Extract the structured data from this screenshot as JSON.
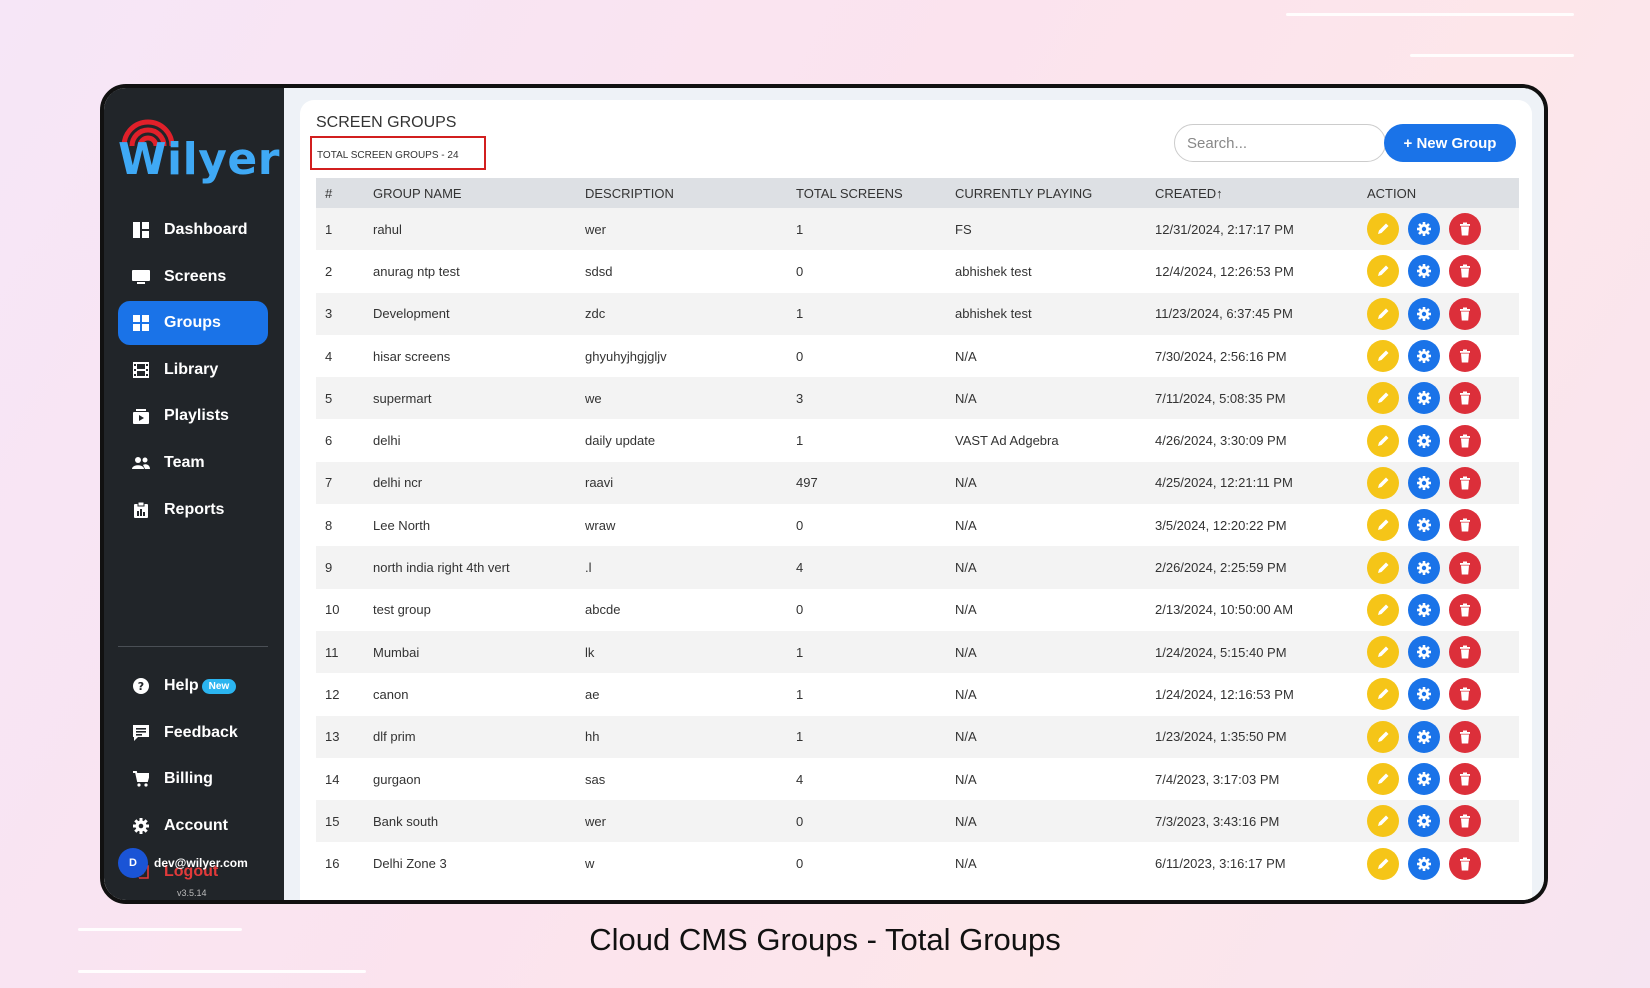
{
  "brand": {
    "name": "Wilyer"
  },
  "sidebar": {
    "items": [
      {
        "label": "Dashboard",
        "icon": "dashboard-icon",
        "active": false
      },
      {
        "label": "Screens",
        "icon": "monitor-icon",
        "active": false
      },
      {
        "label": "Groups",
        "icon": "grid-icon",
        "active": true
      },
      {
        "label": "Library",
        "icon": "film-icon",
        "active": false
      },
      {
        "label": "Playlists",
        "icon": "playlist-icon",
        "active": false
      },
      {
        "label": "Team",
        "icon": "team-icon",
        "active": false
      },
      {
        "label": "Reports",
        "icon": "clipboard-icon",
        "active": false
      }
    ],
    "secondary": [
      {
        "label": "Help",
        "icon": "question-icon",
        "badge": "New"
      },
      {
        "label": "Feedback",
        "icon": "feedback-icon"
      },
      {
        "label": "Billing",
        "icon": "cart-icon"
      },
      {
        "label": "Account",
        "icon": "gear-icon"
      },
      {
        "label": "Logout",
        "icon": "logout-icon"
      }
    ],
    "user": {
      "initial": "D",
      "email": "dev@wilyer.com",
      "version": "v3.5.14"
    }
  },
  "page": {
    "title": "SCREEN GROUPS",
    "total_label": "TOTAL SCREEN GROUPS - 24",
    "search_placeholder": "Search...",
    "new_group_label": "+ New Group"
  },
  "table": {
    "columns": [
      "#",
      "GROUP NAME",
      "DESCRIPTION",
      "TOTAL SCREENS",
      "CURRENTLY PLAYING",
      "CREATED↑",
      "ACTION"
    ],
    "rows": [
      [
        "1",
        "rahul",
        "wer",
        "1",
        "FS",
        "12/31/2024, 2:17:17 PM"
      ],
      [
        "2",
        "anurag ntp test",
        "sdsd",
        "0",
        "abhishek test",
        "12/4/2024, 12:26:53 PM"
      ],
      [
        "3",
        "Development",
        "zdc",
        "1",
        "abhishek test",
        "11/23/2024, 6:37:45 PM"
      ],
      [
        "4",
        "hisar screens",
        "ghyuhyjhgjgljv",
        "0",
        "N/A",
        "7/30/2024, 2:56:16 PM"
      ],
      [
        "5",
        "supermart",
        "we",
        "3",
        "N/A",
        "7/11/2024, 5:08:35 PM"
      ],
      [
        "6",
        "delhi",
        "daily update",
        "1",
        "VAST Ad Adgebra",
        "4/26/2024, 3:30:09 PM"
      ],
      [
        "7",
        "delhi ncr",
        "raavi",
        "497",
        "N/A",
        "4/25/2024, 12:21:11 PM"
      ],
      [
        "8",
        "Lee North",
        "wraw",
        "0",
        "N/A",
        "3/5/2024, 12:20:22 PM"
      ],
      [
        "9",
        "north india right 4th vert",
        ".l",
        "4",
        "N/A",
        "2/26/2024, 2:25:59 PM"
      ],
      [
        "10",
        "test group",
        "abcde",
        "0",
        "N/A",
        "2/13/2024, 10:50:00 AM"
      ],
      [
        "11",
        "Mumbai",
        "lk",
        "1",
        "N/A",
        "1/24/2024, 5:15:40 PM"
      ],
      [
        "12",
        "canon",
        "ae",
        "1",
        "N/A",
        "1/24/2024, 12:16:53 PM"
      ],
      [
        "13",
        "dlf prim",
        "hh",
        "1",
        "N/A",
        "1/23/2024, 1:35:50 PM"
      ],
      [
        "14",
        "gurgaon",
        "sas",
        "4",
        "N/A",
        "7/4/2023, 3:17:03 PM"
      ],
      [
        "15",
        "Bank south",
        "wer",
        "0",
        "N/A",
        "7/3/2023, 3:43:16 PM"
      ],
      [
        "16",
        "Delhi Zone 3",
        "w",
        "0",
        "N/A",
        "6/11/2023, 3:16:17 PM"
      ]
    ]
  },
  "caption": "Cloud CMS Groups - Total Groups",
  "colors": {
    "accent": "#1a73e8",
    "sidebar": "#212529",
    "edit": "#f5c518",
    "settings": "#1a73e8",
    "delete": "#dc2f3a",
    "logout": "#e23a3a",
    "highlight_box": "#d21f1f"
  }
}
